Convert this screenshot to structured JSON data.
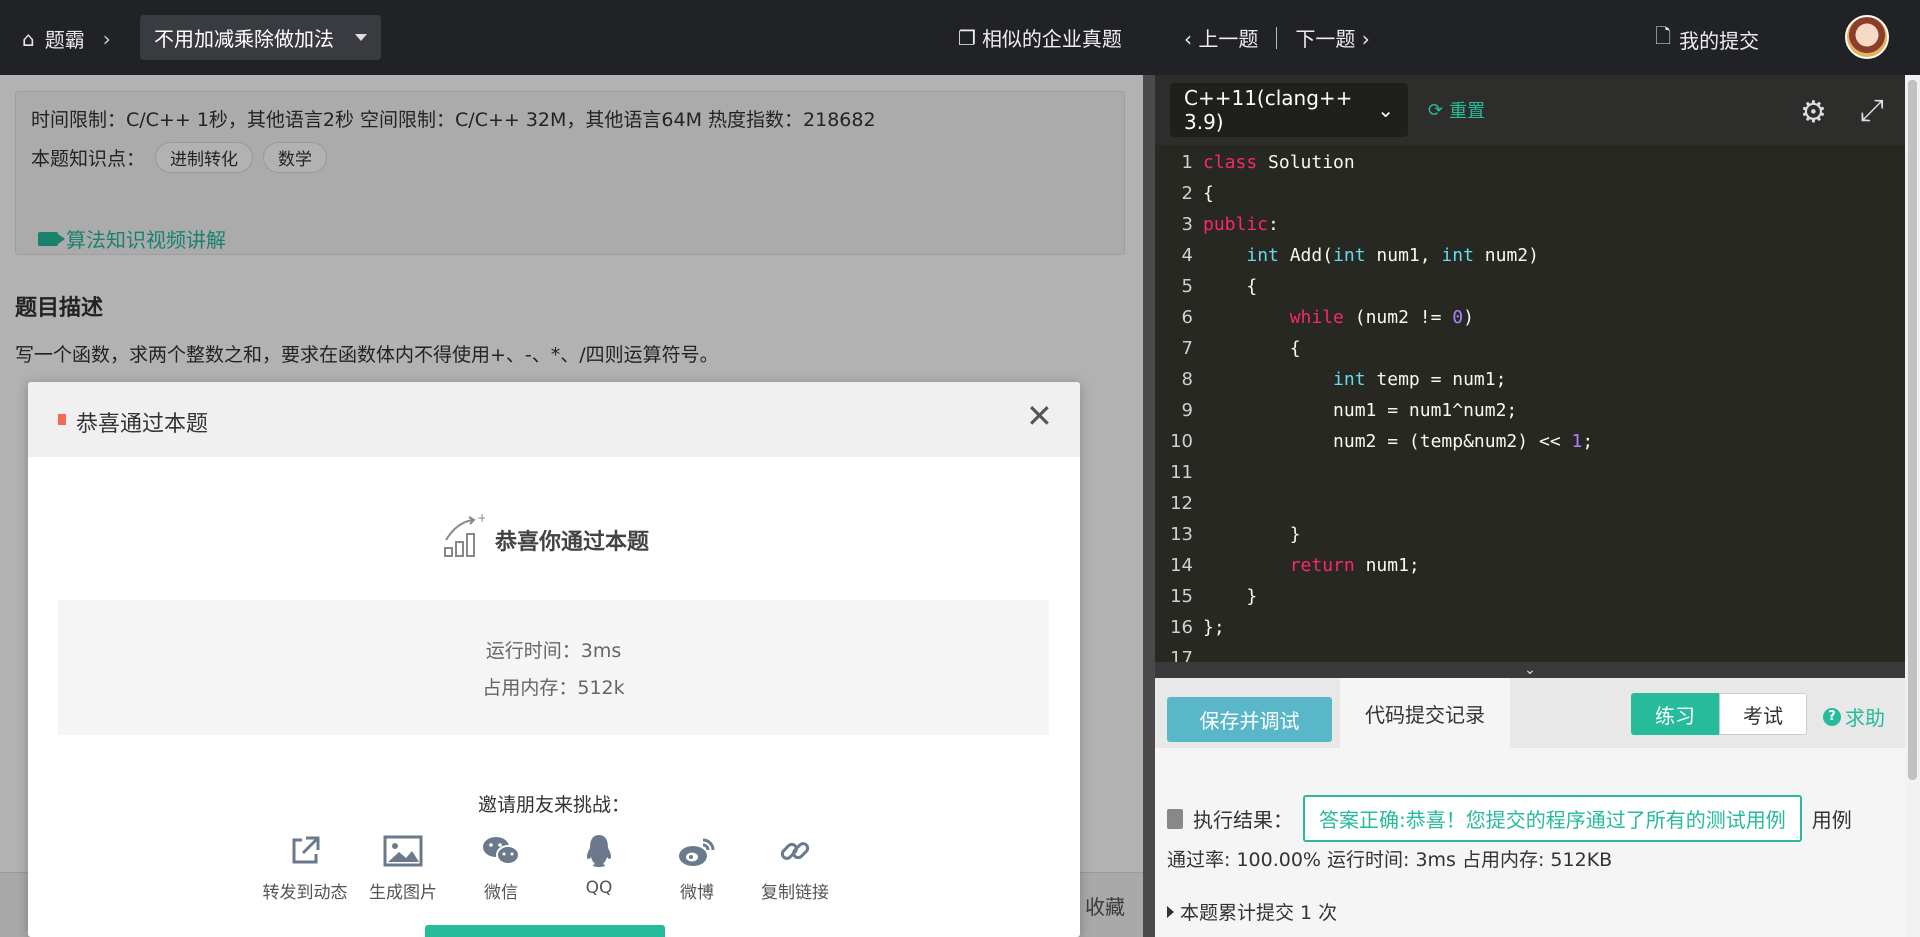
{
  "topbar": {
    "home_label": "题霸",
    "problem_title": "不用加减乘除做加法",
    "similar_label": "相似的企业真题",
    "prev_label": "上一题",
    "next_label": "下一题",
    "my_submission_label": "我的提交"
  },
  "problem": {
    "limits": "时间限制：C/C++ 1秒，其他语言2秒    空间限制：C/C++ 32M，其他语言64M    热度指数：218682",
    "knowledge_label": "本题知识点：",
    "tags": [
      "进制转化",
      "数学"
    ],
    "video_link": "算法知识视频讲解",
    "desc_title": "题目描述",
    "desc_text": "写一个函数，求两个整数之和，要求在函数体内不得使用+、-、*、/四则运算符号。",
    "collect_label": "收藏"
  },
  "editor": {
    "language": "C++11(clang++ 3.9)",
    "reset_label": "重置",
    "code_lines": [
      {
        "n": "1",
        "html": "<span class=\"kw\">class</span> Solution"
      },
      {
        "n": "2",
        "html": "{"
      },
      {
        "n": "3",
        "html": "<span class=\"kw\">public</span>:"
      },
      {
        "n": "4",
        "html": "    <span class=\"ty\">int</span> Add(<span class=\"ty\">int</span> num1, <span class=\"ty\">int</span> num2)"
      },
      {
        "n": "5",
        "html": "    {"
      },
      {
        "n": "6",
        "html": "        <span class=\"kw\">while</span> (num2 != <span class=\"nm\">0</span>)"
      },
      {
        "n": "7",
        "html": "        {"
      },
      {
        "n": "8",
        "html": "            <span class=\"ty\">int</span> temp = num1;"
      },
      {
        "n": "9",
        "html": "            num1 = num1^num2;"
      },
      {
        "n": "10",
        "html": "            num2 = (temp&amp;num2) &lt;&lt; <span class=\"nm\">1</span>;"
      },
      {
        "n": "11",
        "html": ""
      },
      {
        "n": "12",
        "html": ""
      },
      {
        "n": "13",
        "html": "        }"
      },
      {
        "n": "14",
        "html": "        <span class=\"kw\">return</span> num1;"
      },
      {
        "n": "15",
        "html": "    }"
      },
      {
        "n": "16",
        "html": "};"
      },
      {
        "n": "17",
        "html": ""
      }
    ]
  },
  "console": {
    "save_debug_label": "保存并调试",
    "history_tab_label": "代码提交记录",
    "practice_label": "练习",
    "exam_label": "考试",
    "help_label": "求助",
    "result_label": "执行结果：",
    "result_text": "答案正确:恭喜！您提交的程序通过了所有的测试用例",
    "result_suffix": "用例",
    "stats": "通过率: 100.00%   运行时间: 3ms   占用内存: 512KB",
    "cumulative": "本题累计提交 1 次"
  },
  "modal": {
    "title": "恭喜通过本题",
    "congrats": "恭喜你通过本题",
    "runtime": "运行时间：3ms",
    "memory": "占用内存：512k",
    "invite": "邀请朋友来挑战：",
    "shares": [
      {
        "icon": "share-external-icon",
        "label": "转发到动态"
      },
      {
        "icon": "image-icon",
        "label": "生成图片"
      },
      {
        "icon": "wechat-icon",
        "label": "微信"
      },
      {
        "icon": "qq-icon",
        "label": "QQ"
      },
      {
        "icon": "weibo-icon",
        "label": "微博"
      },
      {
        "icon": "link-icon",
        "label": "复制链接"
      }
    ]
  },
  "colors": {
    "accent": "#25bb9b",
    "topbar": "#212226",
    "editor_bg": "#272822"
  }
}
